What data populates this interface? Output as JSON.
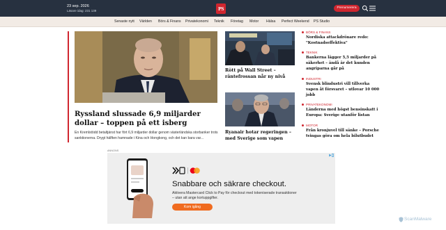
{
  "header": {
    "date": "23 sep. 2026",
    "readers": "Läsare idag: 231 139",
    "logo": "PS",
    "subscribe_label": "Prenumerera",
    "icons": {
      "search": "search-icon",
      "menu": "hamburger-menu-icon"
    }
  },
  "nav": {
    "items": [
      {
        "label": "Senaste nytt"
      },
      {
        "label": "Världen"
      },
      {
        "label": "Börs & Finans"
      },
      {
        "label": "Privatekonomi"
      },
      {
        "label": "Teknik"
      },
      {
        "label": "Företag"
      },
      {
        "label": "Motor"
      },
      {
        "label": "Hälsa"
      },
      {
        "label": "Perfect Weekend"
      },
      {
        "label": "PS Studio"
      }
    ]
  },
  "lead": {
    "title": "Ryssland slussade 6,9 miljarder dollar – toppen på ett isberg",
    "intro": "En Kremlstödd betaltjänst har fört 6,9 miljarder dollar genom västerländska storbanker trots sanktionerna. Drygt hälften hamnade i Kina och Hongkong, och det kan bara var..."
  },
  "middle": [
    {
      "title": "Rött på Wall Street – räntefrossan når ny nivå"
    },
    {
      "title": "Ryanair hotar regeringen – med Sverige som vapen"
    }
  ],
  "right_list": [
    {
      "category": "BÖRS & FINANS",
      "title": "Nordiska attackdrönare redo: \"Kostnadseffektiva\""
    },
    {
      "category": "TEKNIK",
      "title": "Bankerna lägger 5,5 miljarder på säkerhet – ändå är det kunden angriparna går på"
    },
    {
      "category": "INDUSTRI",
      "title": "Svensk blindustri vill tillverka vapen åt försvaret – utlovar 10 000 jobb"
    },
    {
      "category": "PRIVATEKONOMI",
      "title": "Länderna med högst bensinskatt i Europa: Sverige utanför listan"
    },
    {
      "category": "MOTOR",
      "title": "Från kronjuvel till sänke – Porsche tvingas göra om hela bilutbudet"
    }
  ],
  "ad": {
    "label": "ANNONS",
    "headline": "Snabbare och säkrare checkout.",
    "body": "Aktivera Mastercard Click to Pay för checkout med tokeniserade transaktioner – utan att ange kortuppgifter.",
    "button_label": "Kom igång",
    "accent_color": "#f06b1f"
  },
  "watermark": "ScanMalware",
  "colors": {
    "topbar": "#273140",
    "accent_red": "#d0262f",
    "nav_bg": "#f2ebe5"
  }
}
